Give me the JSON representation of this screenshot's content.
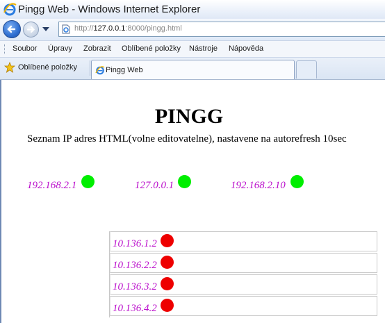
{
  "window": {
    "title": "Pingg Web - Windows Internet Explorer"
  },
  "address": {
    "scheme": "http://",
    "host": "127.0.0.1",
    "rest": ":8000/pingg.html"
  },
  "menu": [
    "Soubor",
    "Úpravy",
    "Zobrazit",
    "Oblíbené položky",
    "Nástroje",
    "Nápověda"
  ],
  "favorites": {
    "label": "Oblíbené položky"
  },
  "tab": {
    "label": "Pingg Web"
  },
  "page": {
    "heading": "PINGG",
    "description": "Seznam IP adres HTML(volne editovatelne), nastavene na autorefresh 10sec",
    "top_hosts": [
      {
        "ip": "192.168.2.1",
        "status": "up"
      },
      {
        "ip": "127.0.0.1",
        "status": "up"
      },
      {
        "ip": "192.168.2.10",
        "status": "up"
      }
    ],
    "table_hosts": [
      {
        "ip": "10.136.1.2",
        "status": "down"
      },
      {
        "ip": "10.136.2.2",
        "status": "down"
      },
      {
        "ip": "10.136.3.2",
        "status": "down"
      },
      {
        "ip": "10.136.4.2",
        "status": "down"
      }
    ]
  },
  "colors": {
    "status_up": "#00ee00",
    "status_down": "#ee0000",
    "link": "#bb11cc"
  }
}
